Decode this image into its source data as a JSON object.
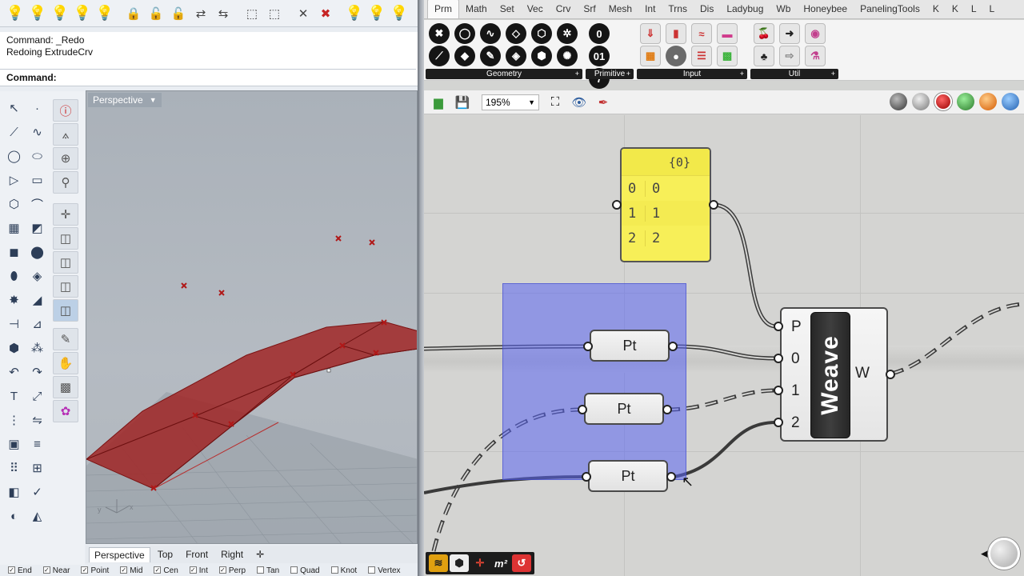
{
  "rhino": {
    "command_history": [
      "Command: _Redo",
      "Redoing ExtrudeCrv"
    ],
    "command_prompt": "Command:",
    "viewport": {
      "title": "Perspective",
      "tabs": [
        "Perspective",
        "Top",
        "Front",
        "Right"
      ],
      "active_tab": "Perspective"
    },
    "osnaps": [
      "End",
      "Near",
      "Point",
      "Mid",
      "Cen",
      "Int",
      "Perp",
      "Tan",
      "Quad",
      "Knot",
      "Vertex"
    ]
  },
  "gh": {
    "tabs": [
      "Prm",
      "Math",
      "Set",
      "Vec",
      "Crv",
      "Srf",
      "Mesh",
      "Int",
      "Trns",
      "Dis",
      "Ladybug",
      "Wb",
      "Honeybee",
      "PanelingTools",
      "K",
      "K",
      "L",
      "L"
    ],
    "active_tab": "Prm",
    "ribbon_groups": [
      "Geometry",
      "Primitive",
      "Input",
      "Util"
    ],
    "zoom": "195%",
    "panel": {
      "header": "{0}",
      "rows": [
        {
          "index": "0",
          "value": "0"
        },
        {
          "index": "1",
          "value": "1"
        },
        {
          "index": "2",
          "value": "2"
        }
      ]
    },
    "pt_components": [
      "Pt",
      "Pt",
      "Pt"
    ],
    "weave": {
      "name": "Weave",
      "inputs": [
        "P",
        "0",
        "1",
        "2"
      ],
      "output": "W"
    },
    "bottom_bar": [
      "m²"
    ]
  }
}
